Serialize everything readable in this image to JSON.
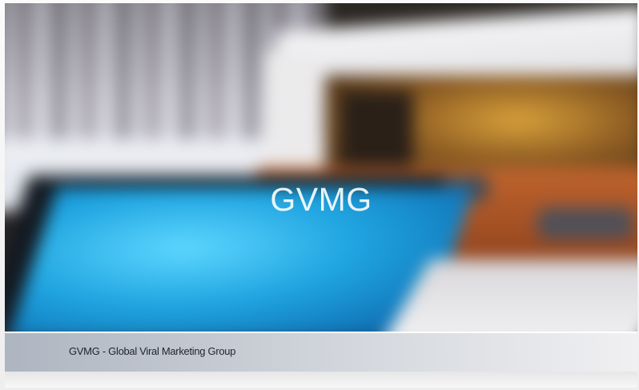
{
  "slide": {
    "title": "GVMG",
    "caption": "GVMG - Global Viral Marketing Group"
  },
  "image": {
    "description_icon": "photo-background"
  },
  "colors": {
    "caption_bar_start": "#aab2be",
    "caption_bar_end": "#f0f0f2",
    "caption_text": "#1e2430",
    "title_text": "#ffffff"
  }
}
